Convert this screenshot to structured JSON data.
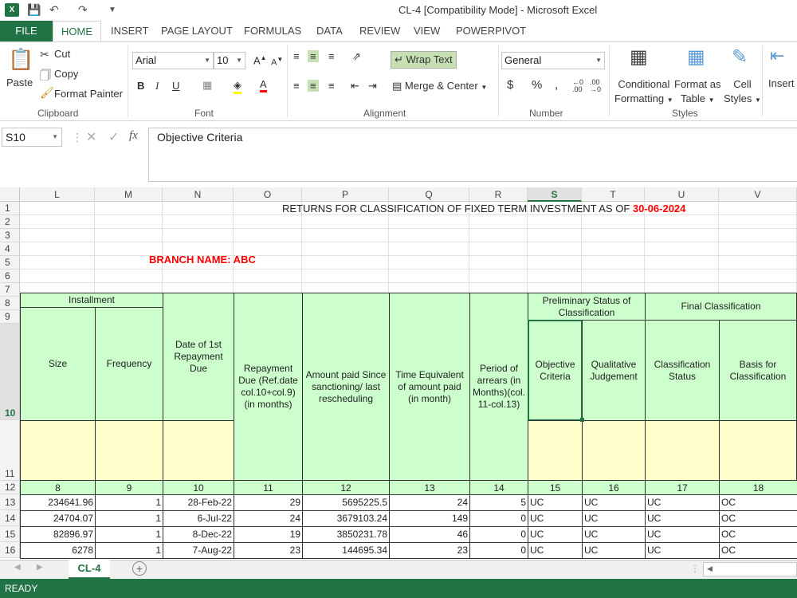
{
  "window": {
    "title": "CL-4  [Compatibility Mode] - Microsoft Excel"
  },
  "tabs": [
    "FILE",
    "HOME",
    "INSERT",
    "PAGE LAYOUT",
    "FORMULAS",
    "DATA",
    "REVIEW",
    "VIEW",
    "POWERPIVOT"
  ],
  "ribbon": {
    "clipboard": {
      "paste": "Paste",
      "cut": "Cut",
      "copy": "Copy",
      "format_painter": "Format Painter",
      "label": "Clipboard"
    },
    "font": {
      "name": "Arial",
      "size": "10",
      "label": "Font"
    },
    "alignment": {
      "wrap_text": "Wrap Text",
      "merge_center": "Merge & Center",
      "label": "Alignment"
    },
    "number": {
      "format": "General",
      "label": "Number"
    },
    "styles": {
      "conditional": "Conditional",
      "conditional2": "Formatting",
      "format_as": "Format as",
      "format_as2": "Table",
      "cell": "Cell",
      "cell2": "Styles",
      "label": "Styles"
    },
    "cells": {
      "insert": "Insert"
    }
  },
  "formula_bar": {
    "name_box": "S10",
    "fx": "fx",
    "value": "Objective Criteria"
  },
  "columns": [
    "L",
    "M",
    "N",
    "O",
    "P",
    "Q",
    "R",
    "S",
    "T",
    "U",
    "V"
  ],
  "rows": [
    "1",
    "2",
    "3",
    "4",
    "5",
    "6",
    "7",
    "8",
    "9",
    "10",
    "11",
    "12",
    "13",
    "14",
    "15",
    "16"
  ],
  "sheet": {
    "title": "RETURNS FOR CLASSIFICATION OF FIXED TERM INVESTMENT AS OF ",
    "title_date": "30-06-2024",
    "branch": "BRANCH NAME: ABC",
    "headers": {
      "installment": "Installment",
      "size": "Size",
      "frequency": "Frequency",
      "date_first": "Date of 1st Repayment Due",
      "repayment_due": "Repayment Due (Ref.date col.10+col.9) (in months)",
      "amount_paid": "Amount paid Since sanctioning/ last rescheduling",
      "time_equiv": "Time Equivalent of amount paid (in month)",
      "period_arrears": "Period of arrears (in Months)(col. 11-col.13)",
      "prelim": "Preliminary Status of Classification",
      "objective": "Objective Criteria",
      "qualitative": "Qualitative Judgement",
      "final": "Final Classification",
      "class_status": "Classification Status",
      "basis": "Basis for Classification"
    },
    "col_numbers": [
      "8",
      "9",
      "10",
      "11",
      "12",
      "13",
      "14",
      "15",
      "16",
      "17",
      "18"
    ],
    "data_rows": [
      [
        "234641.96",
        "1",
        "28-Feb-22",
        "29",
        "5695225.5",
        "24",
        "5",
        "UC",
        "UC",
        "UC",
        "OC"
      ],
      [
        "24704.07",
        "1",
        "6-Jul-22",
        "24",
        "3679103.24",
        "149",
        "0",
        "UC",
        "UC",
        "UC",
        "OC"
      ],
      [
        "82896.97",
        "1",
        "8-Dec-22",
        "19",
        "3850231.78",
        "46",
        "0",
        "UC",
        "UC",
        "UC",
        "OC"
      ],
      [
        "6278",
        "1",
        "7-Aug-22",
        "23",
        "144695.34",
        "23",
        "0",
        "UC",
        "UC",
        "UC",
        "OC"
      ]
    ]
  },
  "sheet_tab": "CL-4",
  "status": "READY",
  "colors": {
    "accent": "#217346",
    "header_fill": "#ccffcc",
    "input_fill": "#ffffcc",
    "red": "#ff0000"
  }
}
